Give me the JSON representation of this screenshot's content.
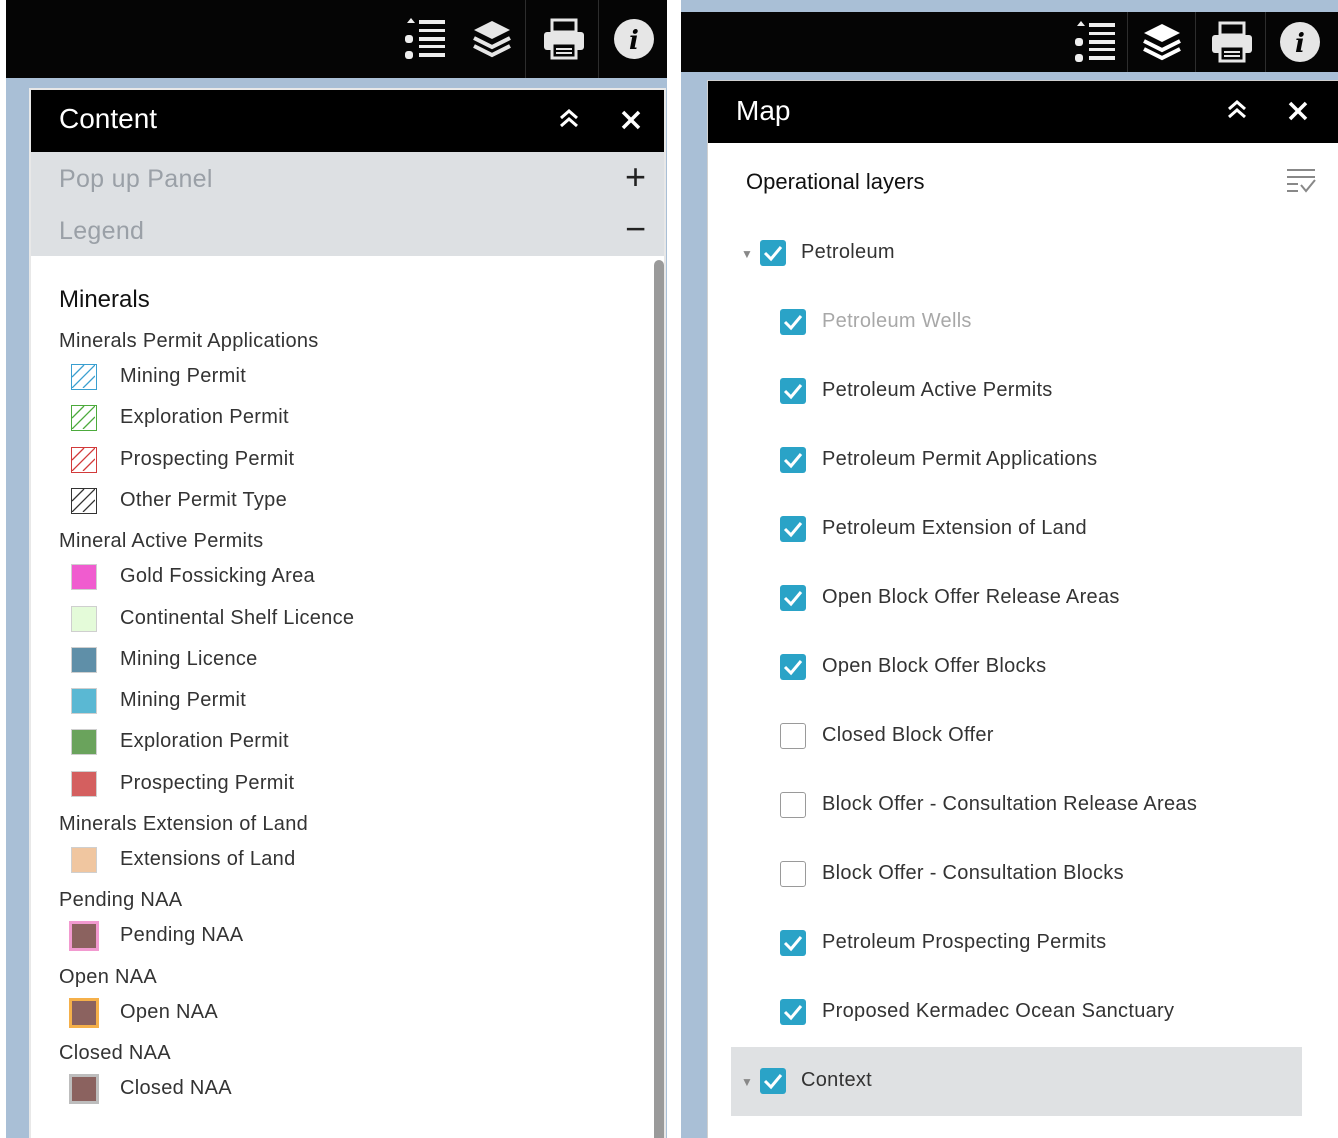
{
  "left": {
    "panel_title": "Content",
    "accordion": [
      {
        "label": "Pop up Panel",
        "symbol": "+"
      },
      {
        "label": "Legend",
        "symbol": "−"
      }
    ],
    "legend": {
      "title": "Minerals",
      "groups": [
        {
          "label": "Minerals Permit Applications",
          "items": [
            {
              "label": "Mining Permit",
              "style": "hatch",
              "color": "#3a9fd0"
            },
            {
              "label": "Exploration Permit",
              "style": "hatch",
              "color": "#4caa3c"
            },
            {
              "label": "Prospecting Permit",
              "style": "hatch",
              "color": "#d23a3a"
            },
            {
              "label": "Other Permit Type",
              "style": "hatch",
              "color": "#333333"
            }
          ]
        },
        {
          "label": "Mineral Active Permits",
          "items": [
            {
              "label": "Gold Fossicking Area",
              "style": "fill",
              "color": "#f05ccf"
            },
            {
              "label": "Continental Shelf Licence",
              "style": "fill",
              "color": "#e4fbd9"
            },
            {
              "label": "Mining Licence",
              "style": "fill",
              "color": "#5f8fa8"
            },
            {
              "label": "Mining Permit",
              "style": "fill",
              "color": "#5ab8d3"
            },
            {
              "label": "Exploration Permit",
              "style": "fill",
              "color": "#6aa35c"
            },
            {
              "label": "Prospecting Permit",
              "style": "fill",
              "color": "#d45f5f"
            }
          ]
        },
        {
          "label": "Minerals Extension of Land",
          "items": [
            {
              "label": "Extensions of Land",
              "style": "fill",
              "color": "#f0c6a0"
            }
          ]
        },
        {
          "label": "Pending NAA",
          "items": [
            {
              "label": "Pending NAA",
              "style": "fill-border",
              "color": "#8b625f",
              "border": "#f29ad0"
            }
          ]
        },
        {
          "label": "Open NAA",
          "items": [
            {
              "label": "Open NAA",
              "style": "fill-border",
              "color": "#8b625f",
              "border": "#f5b04a"
            }
          ]
        },
        {
          "label": "Closed NAA",
          "items": [
            {
              "label": "Closed NAA",
              "style": "fill-border",
              "color": "#8b625f",
              "border": "#bdbdbd"
            }
          ]
        }
      ]
    }
  },
  "right": {
    "panel_title": "Map",
    "section_title": "Operational layers",
    "groups": [
      {
        "label": "Petroleum",
        "checked": true,
        "layers": [
          {
            "label": "Petroleum Wells",
            "checked": true,
            "dimmed": true
          },
          {
            "label": "Petroleum Active Permits",
            "checked": true
          },
          {
            "label": "Petroleum Permit Applications",
            "checked": true
          },
          {
            "label": "Petroleum Extension of Land",
            "checked": true
          },
          {
            "label": "Open Block Offer Release Areas",
            "checked": true
          },
          {
            "label": "Open Block Offer Blocks",
            "checked": true
          },
          {
            "label": "Closed Block Offer",
            "checked": false
          },
          {
            "label": "Block Offer - Consultation Release Areas",
            "checked": false
          },
          {
            "label": "Block Offer - Consultation Blocks",
            "checked": false
          },
          {
            "label": "Petroleum Prospecting Permits",
            "checked": true
          },
          {
            "label": "Proposed Kermadec Ocean Sanctuary",
            "checked": true
          }
        ]
      },
      {
        "label": "Context",
        "checked": true,
        "layers": []
      }
    ]
  },
  "toolbar": {
    "icons": [
      "legend-list-icon",
      "layers-icon",
      "print-icon",
      "info-icon"
    ]
  },
  "colors": {
    "accent": "#2aa3c7",
    "header": "#000000",
    "map_bg": "#a9bfd6"
  }
}
